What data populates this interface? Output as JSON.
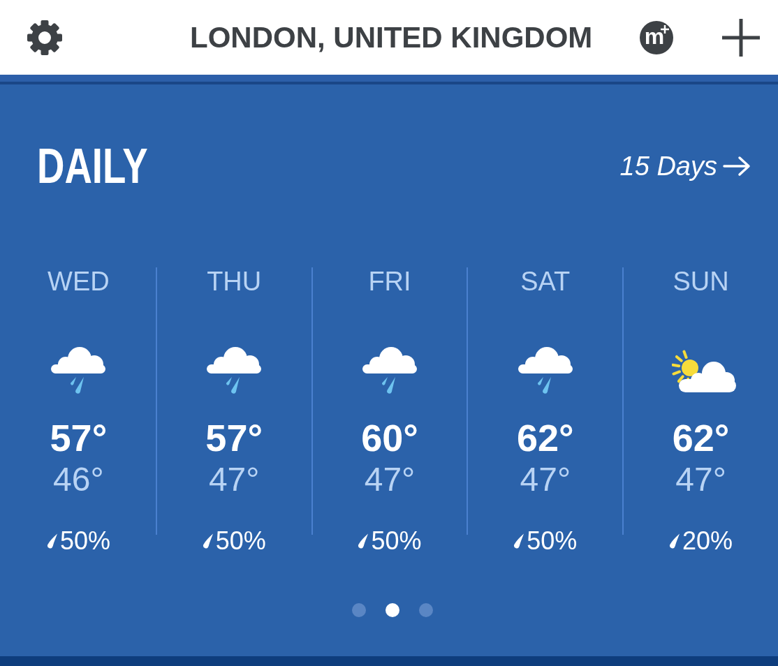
{
  "header": {
    "title": "LONDON, UNITED KINGDOM",
    "logo_letter": "m"
  },
  "section": {
    "title": "DAILY",
    "link": "15 Days"
  },
  "days": [
    {
      "day": "WED",
      "kind": "rain",
      "high": "57°",
      "low": "46°",
      "precip": "50%"
    },
    {
      "day": "THU",
      "kind": "rain",
      "high": "57°",
      "low": "47°",
      "precip": "50%"
    },
    {
      "day": "FRI",
      "kind": "rain",
      "high": "60°",
      "low": "47°",
      "precip": "50%"
    },
    {
      "day": "SAT",
      "kind": "rain",
      "high": "62°",
      "low": "47°",
      "precip": "50%"
    },
    {
      "day": "SUN",
      "kind": "partly-sunny",
      "high": "62°",
      "low": "47°",
      "precip": "20%"
    }
  ],
  "pager": [
    {
      "selected": false
    },
    {
      "selected": true
    },
    {
      "selected": false
    }
  ]
}
